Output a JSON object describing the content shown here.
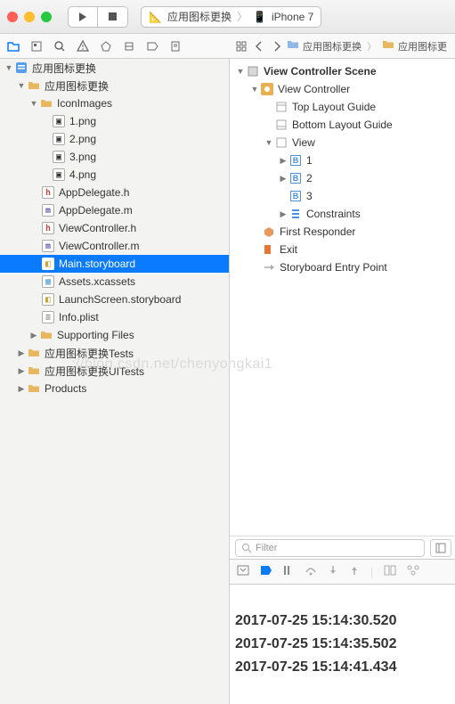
{
  "scheme": {
    "app": "应用图标更换",
    "device": "iPhone 7"
  },
  "breadcrumb": {
    "app": "应用图标更换",
    "file": "应用图标更"
  },
  "navigator": {
    "project": "应用图标更换",
    "target": "应用图标更换",
    "iconImages": "IconImages",
    "images": [
      "1.png",
      "2.png",
      "3.png",
      "4.png"
    ],
    "appDelegateH": "AppDelegate.h",
    "appDelegateM": "AppDelegate.m",
    "viewControllerH": "ViewController.h",
    "viewControllerM": "ViewController.m",
    "mainStoryboard": "Main.storyboard",
    "assets": "Assets.xcassets",
    "launchScreen": "LaunchScreen.storyboard",
    "infoPlist": "Info.plist",
    "supportingFiles": "Supporting Files",
    "tests": "应用图标更换Tests",
    "uiTests": "应用图标更换UITests",
    "products": "Products"
  },
  "outline": {
    "scene": "View Controller Scene",
    "vc": "View Controller",
    "topGuide": "Top Layout Guide",
    "bottomGuide": "Bottom Layout Guide",
    "view": "View",
    "buttons": [
      "1",
      "2",
      "3"
    ],
    "constraints": "Constraints",
    "firstResponder": "First Responder",
    "exit": "Exit",
    "entryPoint": "Storyboard Entry Point"
  },
  "filter": {
    "placeholder": "Filter"
  },
  "console": {
    "lines": [
      "2017-07-25 15:14:30.520",
      "2017-07-25 15:14:35.502",
      "2017-07-25 15:14:41.434"
    ]
  },
  "watermark": "://blog.csdn.net/chenyongkai1"
}
